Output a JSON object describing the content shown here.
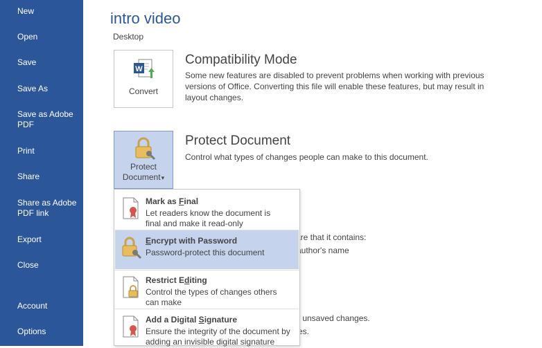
{
  "sidebar": {
    "items": [
      {
        "label": "New"
      },
      {
        "label": "Open"
      },
      {
        "label": "Save"
      },
      {
        "label": "Save As"
      },
      {
        "label": "Save as Adobe",
        "label2": "PDF"
      },
      {
        "label": "Print"
      },
      {
        "label": "Share"
      },
      {
        "label": "Share as Adobe",
        "label2": "PDF link"
      },
      {
        "label": "Export"
      },
      {
        "label": "Close"
      },
      {
        "label": "Account"
      },
      {
        "label": "Options"
      }
    ]
  },
  "document": {
    "title": "intro video",
    "location": "Desktop"
  },
  "compatibility": {
    "button_label": "Convert",
    "title": "Compatibility Mode",
    "description": "Some new features are disabled to prevent problems when working with previous versions of Office. Converting this file will enable these features, but may result in layout changes."
  },
  "protect": {
    "button_line1": "Protect",
    "button_line2": "Document",
    "dropdown_arrow": "▾",
    "title": "Protect Document",
    "description": "Control what types of changes people can make to this document."
  },
  "background_text": {
    "line1": "are that it contains:",
    "line2": "author's name",
    "line3": "r unsaved changes.",
    "line4": "es."
  },
  "dropdown": {
    "items": [
      {
        "title_pre": "Mark as ",
        "title_key": "F",
        "title_post": "inal",
        "description": "Let readers know the document is final and make it read-only"
      },
      {
        "title_pre": "",
        "title_key": "E",
        "title_post": "ncrypt with Password",
        "description": "Password-protect this document"
      },
      {
        "title_pre": "Restrict E",
        "title_key": "d",
        "title_post": "iting",
        "description": "Control the types of changes others can make"
      },
      {
        "title_pre": "Add a Digital ",
        "title_key": "S",
        "title_post": "ignature",
        "description": "Ensure the integrity of the document by adding an invisible digital signature"
      }
    ]
  },
  "colors": {
    "sidebar_bg": "#2b579a",
    "highlight": "#c5d3ec",
    "accent": "#2b579a"
  }
}
